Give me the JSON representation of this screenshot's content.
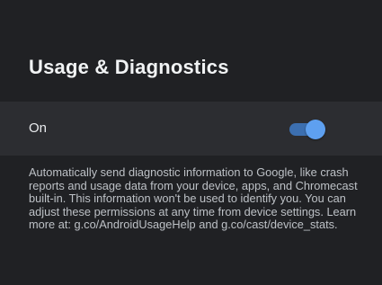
{
  "page": {
    "title": "Usage & Diagnostics"
  },
  "setting": {
    "label": "On",
    "toggle_state": "on",
    "accent_color": "#5ea0f0"
  },
  "description": "Automatically send diagnostic information to Google, like crash reports and usage data from your device, apps, and Chromecast built-in. This information won't be used to identify you. You can adjust these permissions at any time from device settings. Learn more at: g.co/AndroidUsageHelp and g.co/cast/device_stats."
}
